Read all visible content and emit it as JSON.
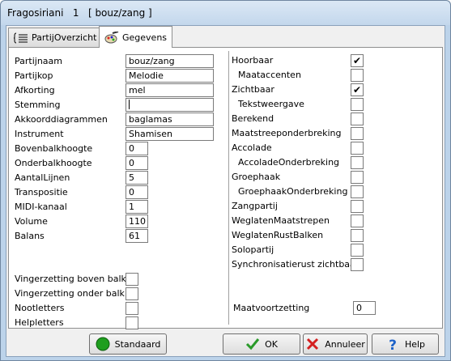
{
  "window": {
    "title": "Fragosiriani   1   [ bouz/zang ]"
  },
  "tabs": [
    {
      "label": "PartijOverzicht",
      "icon": "score-list-icon"
    },
    {
      "label": "Gegevens",
      "icon": "palette-icon"
    }
  ],
  "left_fields": [
    {
      "label": "Partijnaam",
      "value": "bouz/zang"
    },
    {
      "label": "Partijkop",
      "value": "Melodie"
    },
    {
      "label": "Afkorting",
      "value": "mel"
    },
    {
      "label": "Stemming",
      "value": ""
    },
    {
      "label": "Akkoorddiagrammen",
      "value": "baglamas"
    },
    {
      "label": "Instrument",
      "value": "Shamisen"
    },
    {
      "label": "Bovenbalkhoogte",
      "value": "0"
    },
    {
      "label": "Onderbalkhoogte",
      "value": "0"
    },
    {
      "label": "AantalLijnen",
      "value": "5"
    },
    {
      "label": "Transpositie",
      "value": "0"
    },
    {
      "label": "MIDI-kanaal",
      "value": "1"
    },
    {
      "label": "Volume",
      "value": "110"
    },
    {
      "label": "Balans",
      "value": "61"
    }
  ],
  "left_checks": [
    {
      "label": "Vingerzetting boven balk",
      "checked": false
    },
    {
      "label": "Vingerzetting onder balk",
      "checked": false
    },
    {
      "label": "Nootletters",
      "checked": false
    },
    {
      "label": "Helpletters",
      "checked": false
    }
  ],
  "right_checks": [
    {
      "label": "Hoorbaar",
      "checked": true,
      "indent": false
    },
    {
      "label": "Maataccenten",
      "checked": false,
      "indent": true
    },
    {
      "label": "Zichtbaar",
      "checked": true,
      "indent": false
    },
    {
      "label": "Tekstweergave",
      "checked": false,
      "indent": true
    },
    {
      "label": "Berekend",
      "checked": false,
      "indent": false
    },
    {
      "label": "Maatstreeponderbreking",
      "checked": false,
      "indent": false
    },
    {
      "label": "Accolade",
      "checked": false,
      "indent": false
    },
    {
      "label": "AccoladeOnderbreking",
      "checked": false,
      "indent": true
    },
    {
      "label": "Groephaak",
      "checked": false,
      "indent": false
    },
    {
      "label": "GroephaakOnderbreking",
      "checked": false,
      "indent": true
    },
    {
      "label": "Zangpartij",
      "checked": false,
      "indent": false
    },
    {
      "label": "WeglatenMaatstrepen",
      "checked": false,
      "indent": false
    },
    {
      "label": "WeglatenRustBalken",
      "checked": false,
      "indent": false
    },
    {
      "label": "Solopartij",
      "checked": false,
      "indent": false
    },
    {
      "label": "Synchronisatierust zichtbaar",
      "checked": false,
      "indent": false
    }
  ],
  "maatvoortzetting": {
    "label": "Maatvoortzetting",
    "value": "0"
  },
  "check_mark": "✔",
  "buttons": {
    "standaard": "Standaard",
    "ok": "OK",
    "annuleer": "Annuleer",
    "help": "Help"
  },
  "colors": {
    "standaard_icon": "#1e9e1e",
    "ok_icon": "#2a9a2a",
    "cancel_icon": "#d42020",
    "help_icon": "#1d62c9"
  }
}
